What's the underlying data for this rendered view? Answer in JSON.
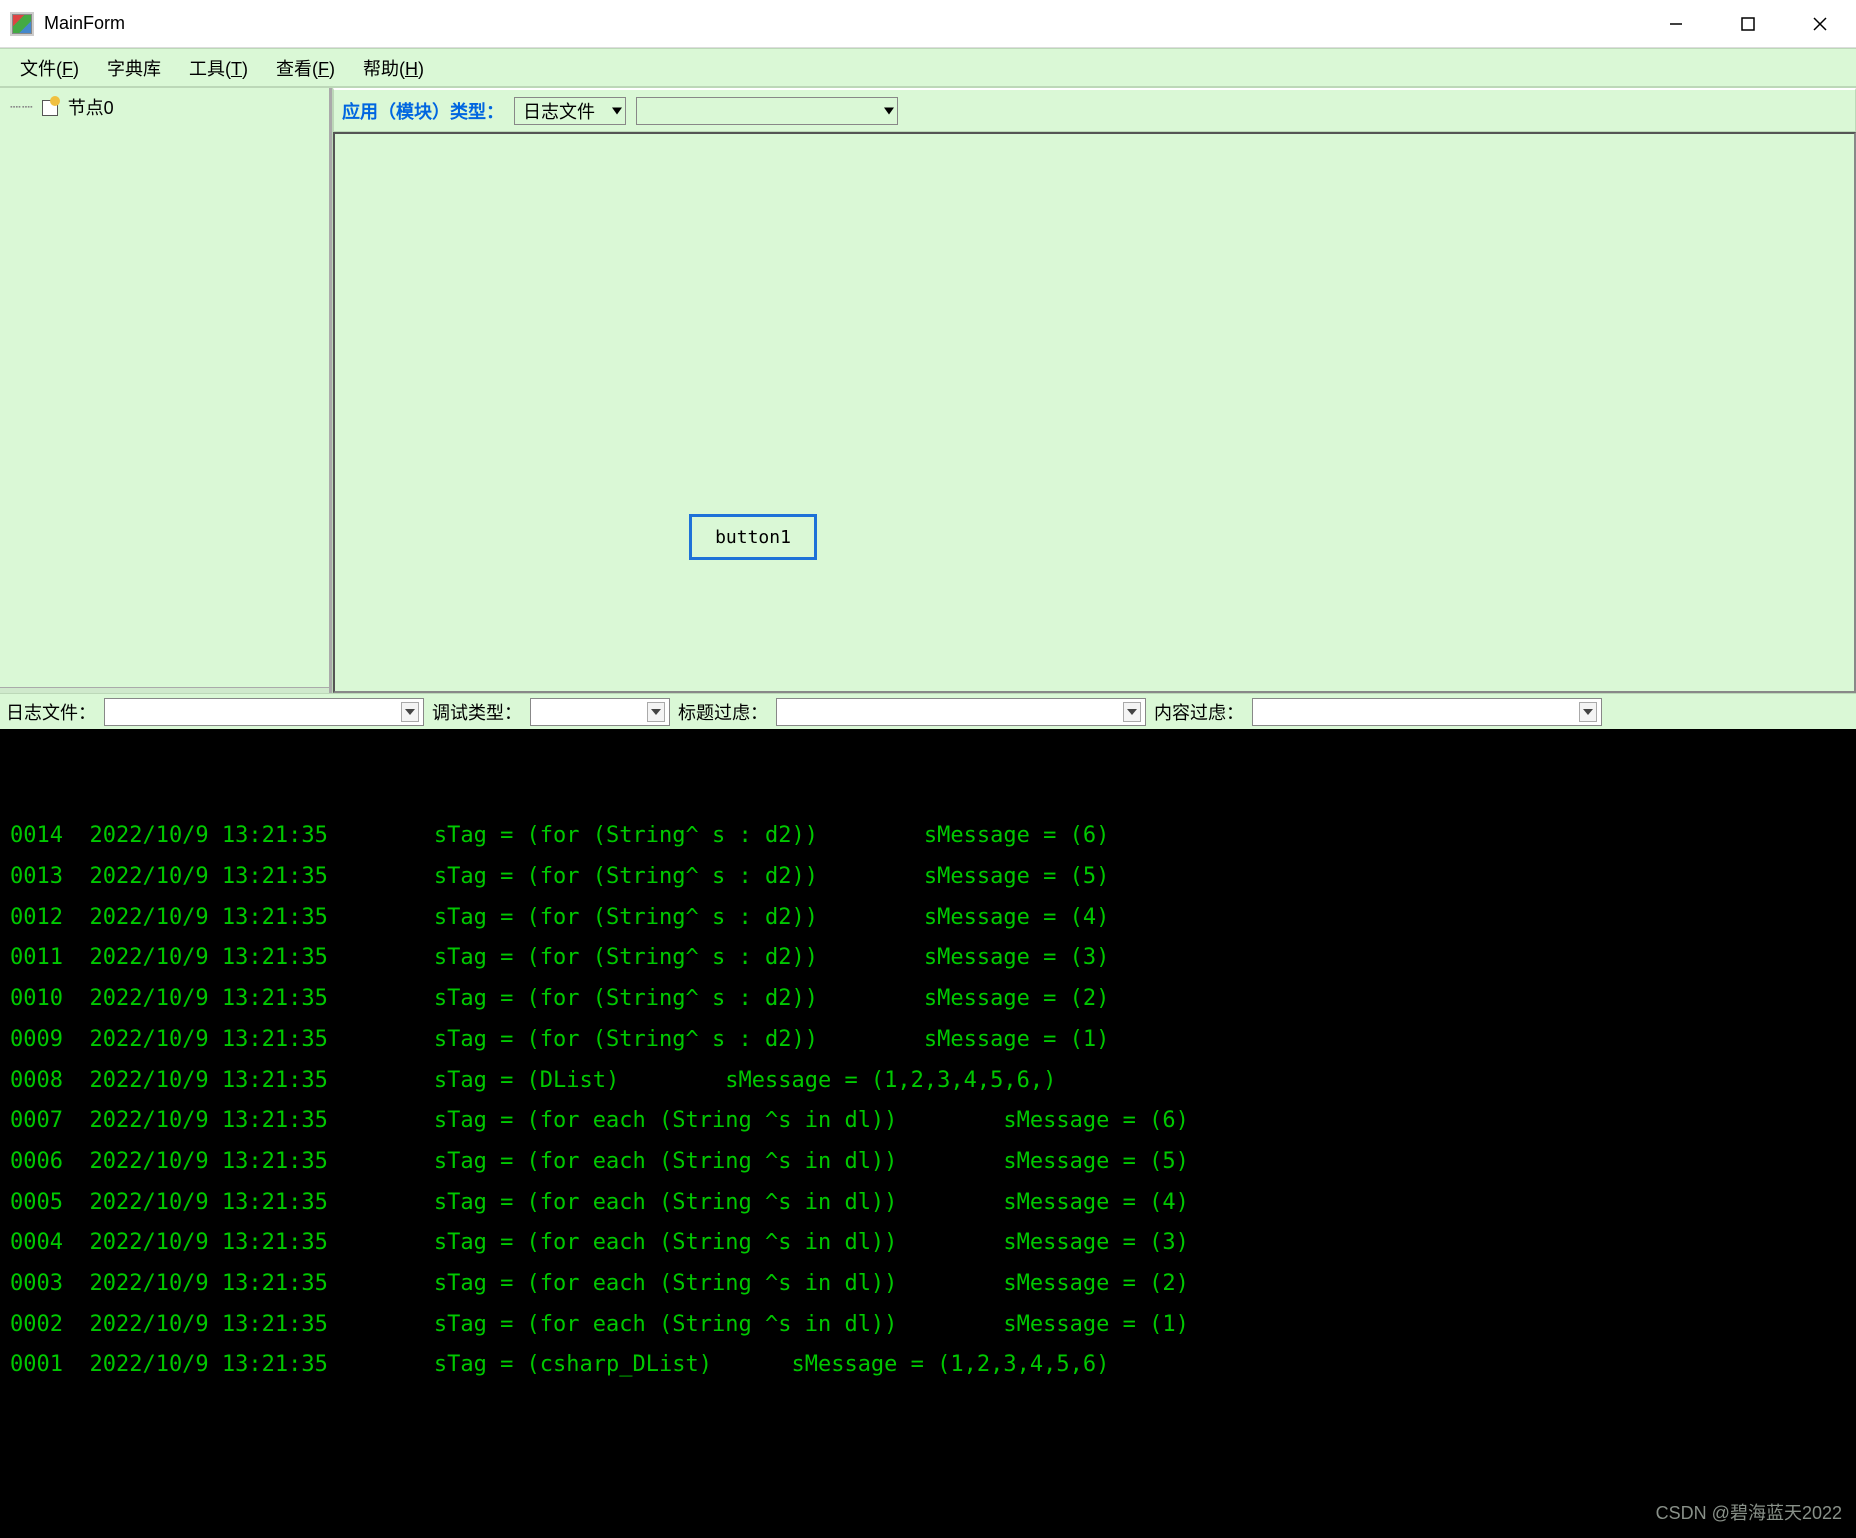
{
  "window": {
    "title": "MainForm"
  },
  "menu": {
    "file": {
      "label_pre": "文件(",
      "key": "F",
      "label_post": ")"
    },
    "dict": {
      "label": "字典库"
    },
    "tools": {
      "label_pre": "工具(",
      "key": "T",
      "label_post": ")"
    },
    "view": {
      "label_pre": "查看(",
      "key": "F",
      "label_post": ")"
    },
    "help": {
      "label_pre": "帮助(",
      "key": "H",
      "label_post": ")"
    }
  },
  "tree": {
    "root_label": "节点0"
  },
  "toolbar": {
    "type_label": "应用（模块）类型：",
    "type_value": "日志文件",
    "secondary_value": ""
  },
  "canvas": {
    "button_label": "button1"
  },
  "filters": {
    "log_file": {
      "label": "日志文件：",
      "value": ""
    },
    "debug_type": {
      "label": "调试类型：",
      "value": ""
    },
    "title": {
      "label": "标题过虑：",
      "value": ""
    },
    "content": {
      "label": "内容过虑：",
      "value": ""
    }
  },
  "log_lines": [
    "0014  2022/10/9 13:21:35        sTag = (for (String^ s : d2))        sMessage = (6)",
    "0013  2022/10/9 13:21:35        sTag = (for (String^ s : d2))        sMessage = (5)",
    "0012  2022/10/9 13:21:35        sTag = (for (String^ s : d2))        sMessage = (4)",
    "0011  2022/10/9 13:21:35        sTag = (for (String^ s : d2))        sMessage = (3)",
    "0010  2022/10/9 13:21:35        sTag = (for (String^ s : d2))        sMessage = (2)",
    "0009  2022/10/9 13:21:35        sTag = (for (String^ s : d2))        sMessage = (1)",
    "0008  2022/10/9 13:21:35        sTag = (DList)        sMessage = (1,2,3,4,5,6,)",
    "0007  2022/10/9 13:21:35        sTag = (for each (String ^s in dl))        sMessage = (6)",
    "0006  2022/10/9 13:21:35        sTag = (for each (String ^s in dl))        sMessage = (5)",
    "0005  2022/10/9 13:21:35        sTag = (for each (String ^s in dl))        sMessage = (4)",
    "0004  2022/10/9 13:21:35        sTag = (for each (String ^s in dl))        sMessage = (3)",
    "0003  2022/10/9 13:21:35        sTag = (for each (String ^s in dl))        sMessage = (2)",
    "0002  2022/10/9 13:21:35        sTag = (for each (String ^s in dl))        sMessage = (1)",
    "0001  2022/10/9 13:21:35        sTag = (csharp_DList)      sMessage = (1,2,3,4,5,6)"
  ],
  "watermark": "CSDN @碧海蓝天2022",
  "colors": {
    "bg_green": "#daf8d6",
    "console_fg": "#00c800",
    "accent_blue": "#1e72d8"
  }
}
